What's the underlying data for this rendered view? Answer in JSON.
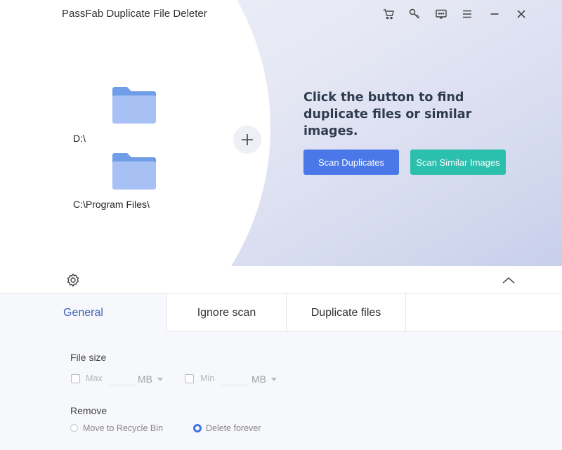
{
  "app": {
    "title": "PassFab Duplicate File Deleter"
  },
  "titlebar": {
    "icons": [
      "cart-icon",
      "key-icon",
      "feedback-icon",
      "menu-icon",
      "minimize-icon",
      "close-icon"
    ]
  },
  "folders": [
    {
      "path": "D:\\"
    },
    {
      "path": "C:\\Program Files\\"
    }
  ],
  "main": {
    "headline": "Click the button to find duplicate files or similar images.",
    "scan_duplicates_label": "Scan Duplicates",
    "scan_similar_label": "Scan Similar Images"
  },
  "tabs": [
    {
      "label": "General",
      "active": true
    },
    {
      "label": "Ignore scan",
      "active": false
    },
    {
      "label": "Duplicate files",
      "active": false
    }
  ],
  "general": {
    "file_size_label": "File size",
    "max_label": "Max",
    "max_value": "",
    "max_unit": "MB",
    "min_label": "Min",
    "min_value": "",
    "min_unit": "MB",
    "remove_label": "Remove",
    "remove_options": [
      {
        "label": "Move to Recycle Bin",
        "selected": false
      },
      {
        "label": "Delete forever",
        "selected": true
      }
    ]
  },
  "colors": {
    "primary_blue": "#4a78e8",
    "teal": "#2bbfae",
    "active_tab": "#3f63b8",
    "folder_blue": "#a7c1f4"
  }
}
